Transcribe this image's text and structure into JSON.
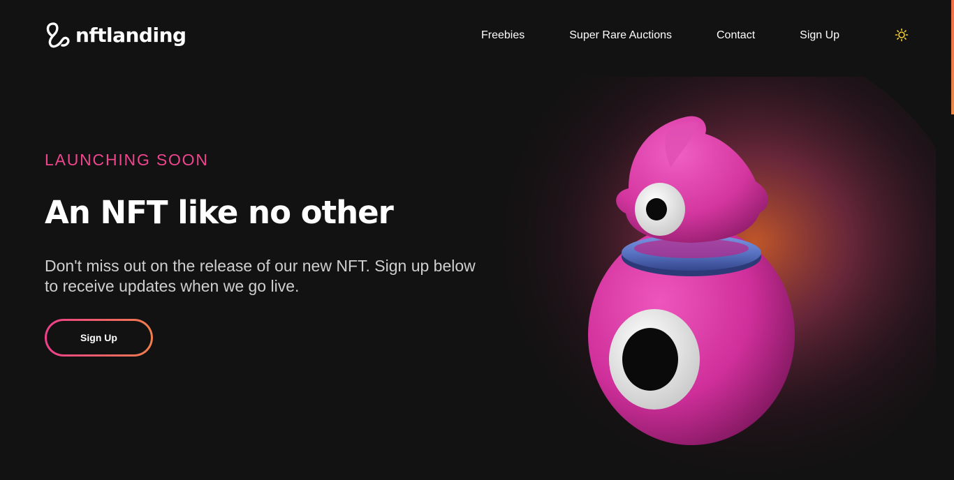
{
  "brand": {
    "name": "nftlanding"
  },
  "nav": {
    "items": [
      {
        "label": "Freebies"
      },
      {
        "label": "Super Rare Auctions"
      },
      {
        "label": "Contact"
      },
      {
        "label": "Sign Up"
      }
    ]
  },
  "theme_toggle": {
    "icon": "sun-icon",
    "color": "#f5d130"
  },
  "hero": {
    "eyebrow": "LAUNCHING SOON",
    "headline": "An NFT like no other",
    "subtext": "Don't miss out on the release of our new NFT. Sign up below to receive updates when we go live.",
    "cta_label": "Sign Up",
    "image": "pink-one-eyed-creature-illustration"
  },
  "colors": {
    "background": "#121212",
    "accent_pink": "#f0458e",
    "accent_orange": "#f07e4d",
    "creature_pink": "#d7359f",
    "creature_ring": "#5a74c4"
  }
}
